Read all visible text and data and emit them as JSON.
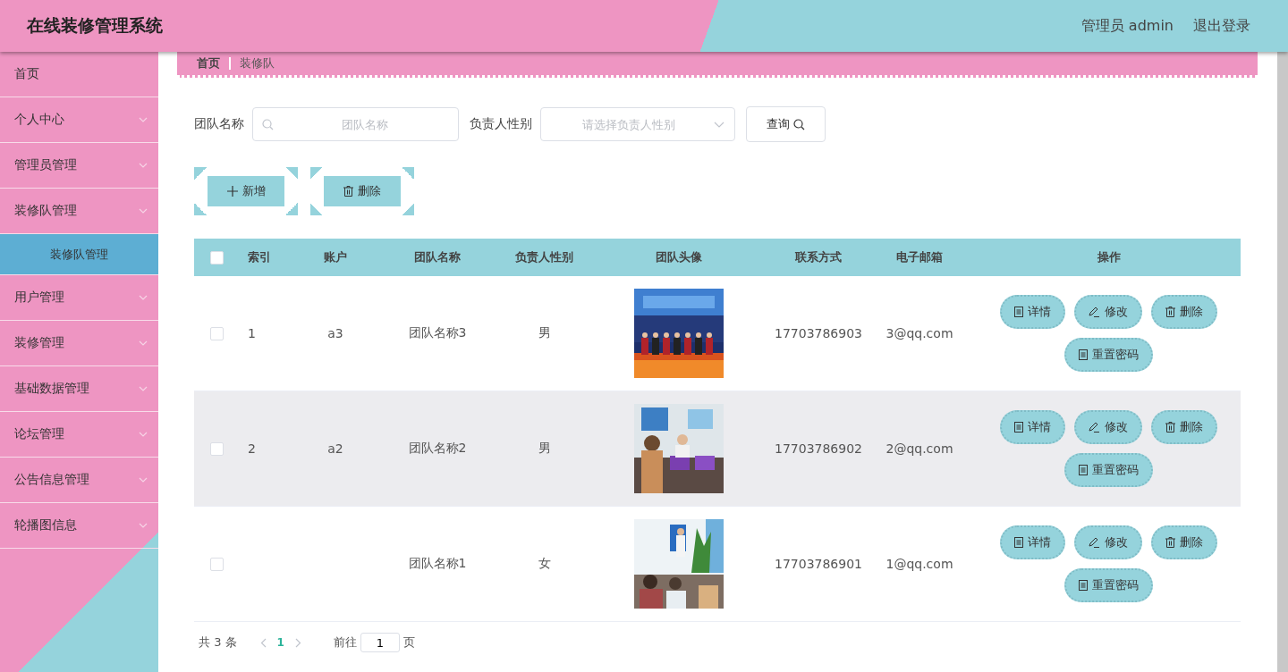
{
  "header": {
    "title": "在线装修管理系统",
    "user": "管理员 admin",
    "logout": "退出登录"
  },
  "breadcrumb": [
    "首页",
    "装修队"
  ],
  "sidebar": {
    "items": [
      {
        "label": "首页",
        "kind": "link",
        "selected": false
      },
      {
        "label": "个人中心",
        "kind": "menu",
        "selected": false
      },
      {
        "label": "管理员管理",
        "kind": "menu",
        "selected": false
      },
      {
        "label": "装修队管理",
        "kind": "menu",
        "selected": false,
        "children": [
          {
            "label": "装修队管理",
            "selected": true
          }
        ]
      },
      {
        "label": "用户管理",
        "kind": "menu",
        "selected": false
      },
      {
        "label": "装修管理",
        "kind": "menu",
        "selected": false
      },
      {
        "label": "基础数据管理",
        "kind": "menu",
        "selected": false
      },
      {
        "label": "论坛管理",
        "kind": "menu",
        "selected": false
      },
      {
        "label": "公告信息管理",
        "kind": "menu",
        "selected": false
      },
      {
        "label": "轮播图信息",
        "kind": "menu",
        "selected": false
      }
    ]
  },
  "search": {
    "fields": [
      {
        "label": "团队名称",
        "kind": "text",
        "placeholder": "团队名称"
      },
      {
        "label": "负责人性别",
        "kind": "select",
        "placeholder": "请选择负责人性别"
      }
    ],
    "button": "查询"
  },
  "actions": [
    {
      "label": "新增",
      "kind": "add"
    },
    {
      "label": "删除",
      "kind": "delete"
    }
  ],
  "table": {
    "select_all": {
      "checked": false
    },
    "columns": [
      "索引",
      "账户",
      "团队名称",
      "负责人性别",
      "团队头像",
      "联系方式",
      "电子邮箱",
      "操作"
    ],
    "rows": [
      {
        "checked": false,
        "hovered": false,
        "index": "1",
        "account": "a3",
        "team_name": "团队名称3",
        "gender": "男",
        "phone": "17703786903",
        "email": "3@qq.com",
        "actions": [
          {
            "label": "详情",
            "kind": "detail"
          },
          {
            "label": "修改",
            "kind": "edit"
          },
          {
            "label": "删除",
            "kind": "delete"
          },
          {
            "label": "重置密码",
            "kind": "detail"
          }
        ]
      },
      {
        "checked": false,
        "hovered": true,
        "index": "2",
        "account": "a2",
        "team_name": "团队名称2",
        "gender": "男",
        "phone": "17703786902",
        "email": "2@qq.com",
        "actions": [
          {
            "label": "详情",
            "kind": "detail"
          },
          {
            "label": "修改",
            "kind": "edit"
          },
          {
            "label": "删除",
            "kind": "delete"
          },
          {
            "label": "重置密码",
            "kind": "detail"
          }
        ]
      },
      {
        "checked": false,
        "hovered": false,
        "team_name": "团队名称1",
        "gender": "女",
        "phone": "17703786901",
        "email": "1@qq.com",
        "actions": [
          {
            "label": "详情",
            "kind": "detail"
          },
          {
            "label": "修改",
            "kind": "edit"
          },
          {
            "label": "删除",
            "kind": "delete"
          },
          {
            "label": "重置密码",
            "kind": "detail"
          }
        ]
      }
    ]
  },
  "pagination": {
    "total": "共 3 条",
    "pages": [
      {
        "label": "1",
        "selected": true
      }
    ],
    "goto": "前往",
    "page_input": "1",
    "suffix": "页"
  }
}
